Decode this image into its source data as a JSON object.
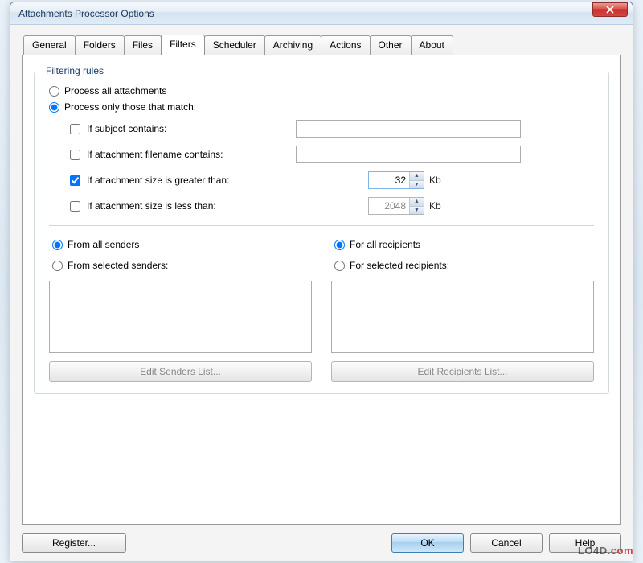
{
  "window": {
    "title": "Attachments Processor Options"
  },
  "tabs": {
    "items": [
      "General",
      "Folders",
      "Files",
      "Filters",
      "Scheduler",
      "Archiving",
      "Actions",
      "Other",
      "About"
    ],
    "active": 3
  },
  "fieldset": {
    "legend": "Filtering rules"
  },
  "rules": {
    "process_all": "Process all attachments",
    "process_match": "Process only those that match:",
    "match_selected": true,
    "subject": {
      "label": "If subject contains:",
      "checked": false,
      "value": ""
    },
    "filename": {
      "label": "If attachment filename contains:",
      "checked": false,
      "value": ""
    },
    "size_gt": {
      "label": "If attachment size is greater than:",
      "checked": true,
      "value": "32",
      "unit": "Kb"
    },
    "size_lt": {
      "label": "If attachment size is less than:",
      "checked": false,
      "value": "2048",
      "unit": "Kb"
    }
  },
  "senders": {
    "all": "From all senders",
    "selected": "From selected senders:",
    "all_selected": true,
    "edit_btn": "Edit Senders List..."
  },
  "recipients": {
    "all": "For all recipients",
    "selected": "For selected recipients:",
    "all_selected": true,
    "edit_btn": "Edit Recipients List..."
  },
  "buttons": {
    "register": "Register...",
    "ok": "OK",
    "cancel": "Cancel",
    "help": "Help"
  },
  "watermark": {
    "a": "LO4D",
    "b": ".com"
  }
}
